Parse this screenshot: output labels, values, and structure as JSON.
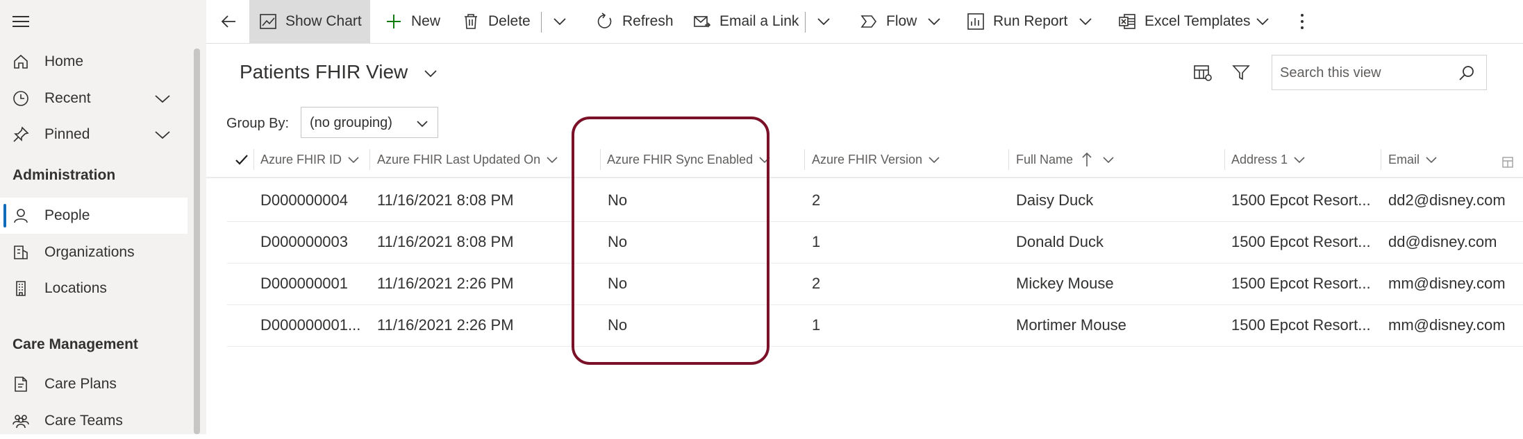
{
  "sidebar": {
    "items": [
      {
        "label": "Home",
        "icon": "home-icon"
      },
      {
        "label": "Recent",
        "icon": "clock-icon"
      },
      {
        "label": "Pinned",
        "icon": "pin-icon"
      }
    ],
    "section_admin": "Administration",
    "admin_items": [
      {
        "label": "People",
        "icon": "person-icon"
      },
      {
        "label": "Organizations",
        "icon": "organization-icon"
      },
      {
        "label": "Locations",
        "icon": "building-icon"
      }
    ],
    "section_care": "Care Management",
    "care_items": [
      {
        "label": "Care Plans",
        "icon": "care-plan-icon"
      },
      {
        "label": "Care Teams",
        "icon": "people-team-icon"
      }
    ]
  },
  "toolbar": {
    "show_chart": "Show Chart",
    "new": "New",
    "delete": "Delete",
    "refresh": "Refresh",
    "email_link": "Email a Link",
    "flow": "Flow",
    "run_report": "Run Report",
    "excel_templates": "Excel Templates"
  },
  "view": {
    "title": "Patients FHIR View",
    "search_placeholder": "Search this view",
    "group_by_label": "Group By:",
    "group_by_value": "(no grouping)"
  },
  "grid": {
    "columns": [
      "Azure FHIR ID",
      "Azure FHIR Last Updated On",
      "Azure FHIR Sync Enabled",
      "Azure FHIR Version",
      "Full Name",
      "Address 1",
      "Email"
    ],
    "rows": [
      [
        "D000000004",
        "11/16/2021 8:08 PM",
        "No",
        "2",
        "Daisy Duck",
        "1500 Epcot Resort...",
        "dd2@disney.com"
      ],
      [
        "D000000003",
        "11/16/2021 8:08 PM",
        "No",
        "1",
        "Donald Duck",
        "1500 Epcot Resort...",
        "dd@disney.com"
      ],
      [
        "D000000001",
        "11/16/2021 2:26 PM",
        "No",
        "2",
        "Mickey Mouse",
        "1500 Epcot Resort...",
        "mm@disney.com"
      ],
      [
        "D000000001...",
        "11/16/2021 2:26 PM",
        "No",
        "1",
        "Mortimer Mouse",
        "1500 Epcot Resort...",
        "mm@disney.com"
      ]
    ]
  },
  "colors": {
    "highlight_border": "#7b1128",
    "accent": "#0f6cbd"
  }
}
